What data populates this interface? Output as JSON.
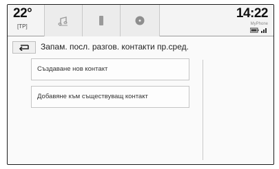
{
  "status": {
    "temperature": "22°",
    "temp_sub": "[TP]",
    "clock": "14:22",
    "phone_name": "MyPhone"
  },
  "tabs": [
    {
      "icon": "music-note-icon"
    },
    {
      "icon": "phone-icon"
    },
    {
      "icon": "disc-icon"
    }
  ],
  "header": {
    "title": "Запам. посл. разгов. контакти пр.сред."
  },
  "list": {
    "items": [
      {
        "label": "Създаване нов контакт"
      },
      {
        "label": "Добавяне към съществуващ контакт"
      }
    ]
  },
  "colors": {
    "frame": "#1a1a1a",
    "border": "#c4c4c4",
    "text": "#222222"
  }
}
